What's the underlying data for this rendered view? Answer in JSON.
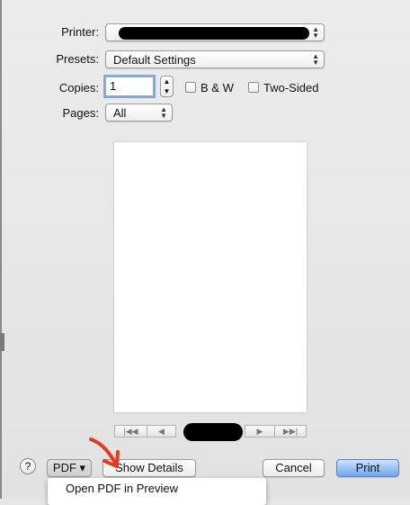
{
  "printer": {
    "label": "Printer:"
  },
  "presets": {
    "label": "Presets:",
    "value": "Default Settings"
  },
  "copies": {
    "label": "Copies:",
    "value": "1"
  },
  "bw": {
    "label": "B & W"
  },
  "two_sided": {
    "label": "Two-Sided"
  },
  "pages": {
    "label": "Pages:",
    "value": "All"
  },
  "nav": {
    "first": "|◀◀",
    "prev": "◀",
    "next": "▶",
    "last": "▶▶|"
  },
  "footer": {
    "help": "?",
    "pdf": "PDF ▾",
    "show_details": "Show Details",
    "cancel": "Cancel",
    "print": "Print"
  },
  "pdf_menu": {
    "items": [
      "Open PDF in Preview"
    ]
  },
  "colors": {
    "accent": "#6ea6ee",
    "annotation_arrow": "#e8391f"
  }
}
